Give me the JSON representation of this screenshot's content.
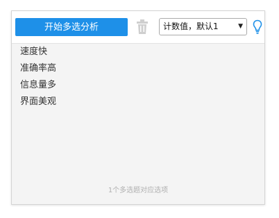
{
  "toolbar": {
    "start_button_label": "开始多选分析",
    "mode_select_value": "计数值，默认1",
    "colors": {
      "primary": "#1e90e8",
      "icon_gray": "#cfcfcf",
      "bulb": "#1e90e8"
    },
    "icons": [
      "trash-icon",
      "lightbulb-icon",
      "dropdown-arrow-icon"
    ]
  },
  "options": [
    {
      "label": "速度快"
    },
    {
      "label": "准确率高"
    },
    {
      "label": "信息量多"
    },
    {
      "label": "界面美观"
    }
  ],
  "footer": {
    "note": "1个多选题对应选项"
  }
}
